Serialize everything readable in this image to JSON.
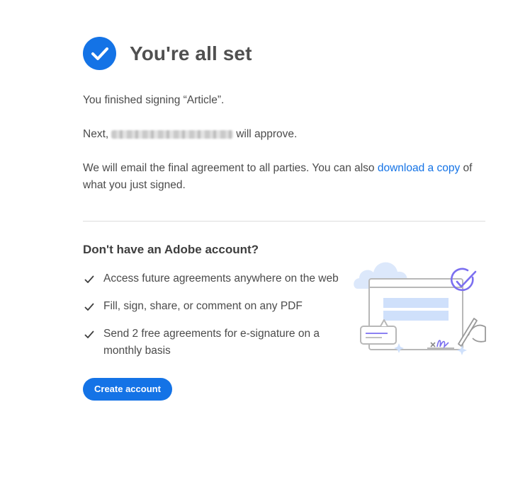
{
  "header": {
    "title": "You're all set"
  },
  "messages": {
    "signed": "You finished signing “Article”.",
    "next_prefix": "Next,",
    "next_suffix": "will approve.",
    "email_prefix": "We will email the final agreement to all parties. You can also",
    "download_link": "download a copy",
    "email_suffix": "of what you just signed."
  },
  "promo": {
    "title": "Don't have an Adobe account?",
    "features": [
      "Access future agreements anywhere on the web",
      "Fill, sign, share, or comment on any PDF",
      "Send 2 free agreements for e-signature on a monthly basis"
    ],
    "button_label": "Create account"
  },
  "colors": {
    "accent": "#1473e6",
    "text": "#4b4b4b",
    "illustration_purple": "#7b6ff0"
  }
}
